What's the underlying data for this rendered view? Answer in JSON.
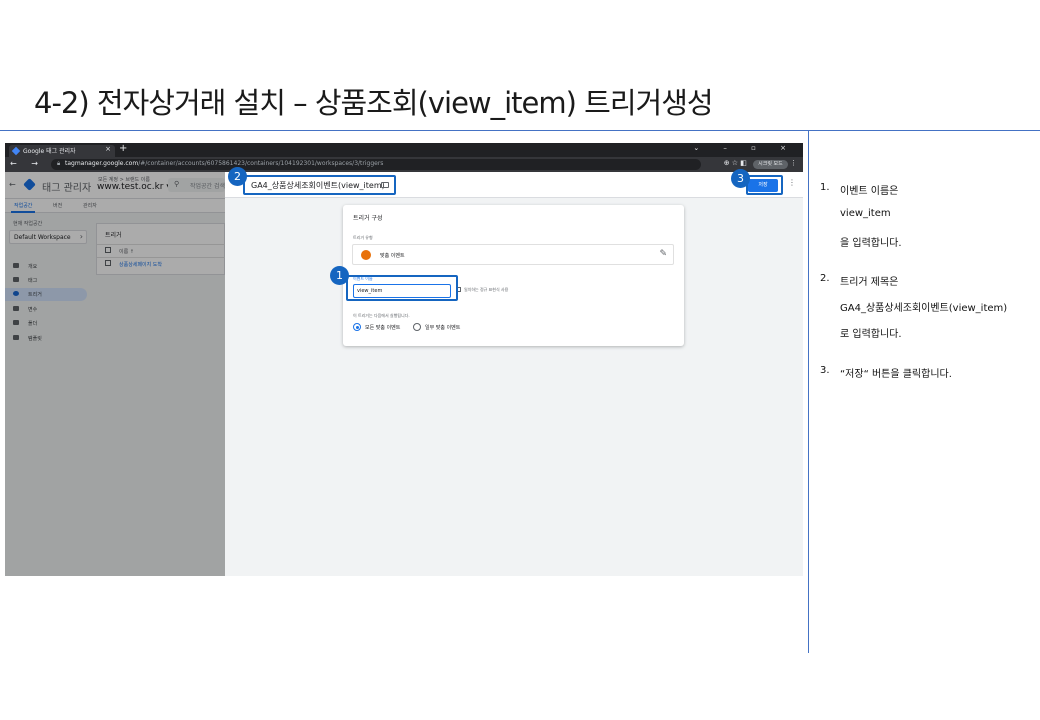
{
  "slide": {
    "title": "4-2) 전자상거래 설치 – 상품조회(view_item) 트리거생성"
  },
  "browser": {
    "tab_title": "Google 태그 관리자",
    "tab_close": "×",
    "new_tab": "+",
    "window_controls": "⌄ – ▫ ×",
    "nav": "← → C",
    "url_host": "tagmanager.google.com",
    "url_path": "/#/container/accounts/6075861423/containers/104192301/workspaces/3/triggers",
    "toolbar_icons": "⊕ ☆ ◧",
    "profile": "시크릿 모드",
    "menu": "⋮"
  },
  "gtm": {
    "back": "←",
    "product_name": "태그 관리자",
    "account_path": "모든 계정 > 브랜드 이름",
    "container": "www.test.oc.kr ▾",
    "search_placeholder": "작업공간 검색",
    "subtabs": [
      "작업공간",
      "버전",
      "관리자"
    ],
    "workspace_label": "현재 작업공간",
    "workspace": "Default Workspace",
    "workspace_chevron": "›",
    "nav": [
      "개요",
      "태그",
      "트리거",
      "변수",
      "폴더",
      "템플릿"
    ],
    "list_title": "트리거",
    "list_col_name": "이름 ↑",
    "list_row": "상품상세페이지 도착"
  },
  "panel": {
    "close": "✕",
    "trigger_name": "GA4_상품상세조회이벤트(view_item)",
    "save": "저장",
    "more": "⋮",
    "card_title": "트리거 구성",
    "type_label": "트리거 유형",
    "type_value": "맞춤 이벤트",
    "edit_icon": "✎",
    "event_name_label": "이벤트 이름",
    "event_name_value": "view_item",
    "regex_label": "일치하는 정규 표현식 사용",
    "fires_on_label": "이 트리거는 다음에서 실행됩니다.",
    "radio_all": "모든 맞춤 이벤트",
    "radio_some": "일부 맞춤 이벤트"
  },
  "badges": [
    "1",
    "2",
    "3"
  ],
  "notes": {
    "n1_num": "1.",
    "n1_a": "이벤트 이름은",
    "n1_b": "view_item",
    "n1_c": "을 입력합니다.",
    "n2_num": "2.",
    "n2_a": "트리거 제목은",
    "n2_b": "GA4_상품상세조회이벤트(view_item)",
    "n2_c": "로 입력합니다.",
    "n3_num": "3.",
    "n3_a": "“저장“ 버튼을 클릭합니다."
  },
  "colors": {
    "accent": "#1a73e8",
    "highlight": "#1565c0",
    "rule": "#4472c4"
  }
}
